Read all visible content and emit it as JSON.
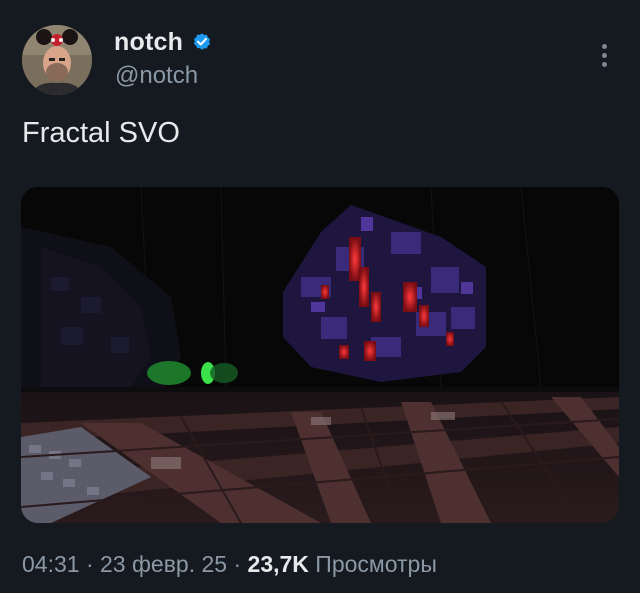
{
  "author": {
    "display_name": "notch",
    "handle": "@notch",
    "verified": true,
    "avatar": "avatar-photo"
  },
  "tweet": {
    "text": "Fractal SVO",
    "media": "voxel-render-image"
  },
  "meta": {
    "time": "04:31",
    "separator": " · ",
    "date": "23 февр. 25",
    "views_count": "23,7K",
    "views_label": " Просмотры"
  },
  "icons": {
    "verified": "verified-badge-icon",
    "more": "more-options-icon"
  },
  "colors": {
    "background": "#151a21",
    "text_primary": "#e7e9ea",
    "text_secondary": "#8b98a5",
    "verified_blue": "#1d9bf0"
  }
}
